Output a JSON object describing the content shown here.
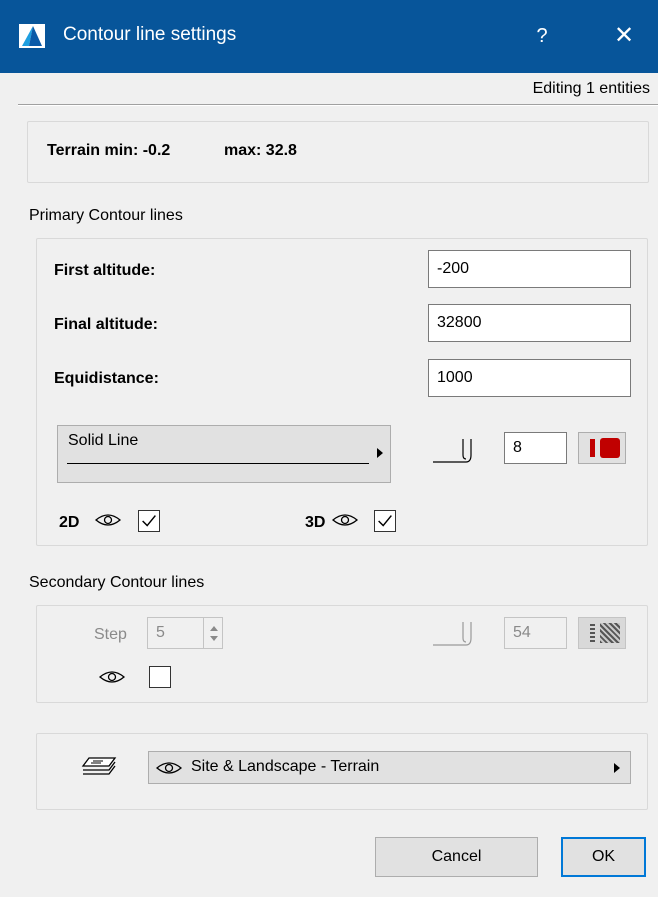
{
  "window": {
    "title": "Contour line settings",
    "help_label": "?",
    "close_label": "✕",
    "editing_label": "Editing 1 entities"
  },
  "terrain": {
    "min_label": "Terrain min: -0.2",
    "max_label": "max: 32.8"
  },
  "primary": {
    "section_label": "Primary Contour lines",
    "first_altitude_label": "First altitude:",
    "first_altitude_value": "-200",
    "final_altitude_label": "Final altitude:",
    "final_altitude_value": "32800",
    "equidistance_label": "Equidistance:",
    "equidistance_value": "1000",
    "line_type_label": "Solid Line",
    "pen_value": "8",
    "pen_color": "#c00000",
    "view_2d_label": "2D",
    "view_3d_label": "3D",
    "show_2d": true,
    "show_3d": true
  },
  "secondary": {
    "section_label": "Secondary Contour lines",
    "step_label": "Step",
    "step_value": "5",
    "pen_value": "54",
    "show": false
  },
  "layer": {
    "name": "Site & Landscape - Terrain"
  },
  "buttons": {
    "cancel_label": "Cancel",
    "ok_label": "OK"
  },
  "colors": {
    "titlebar": "#07559a",
    "default_button_border": "#0078d7",
    "pen_red": "#c00000"
  }
}
